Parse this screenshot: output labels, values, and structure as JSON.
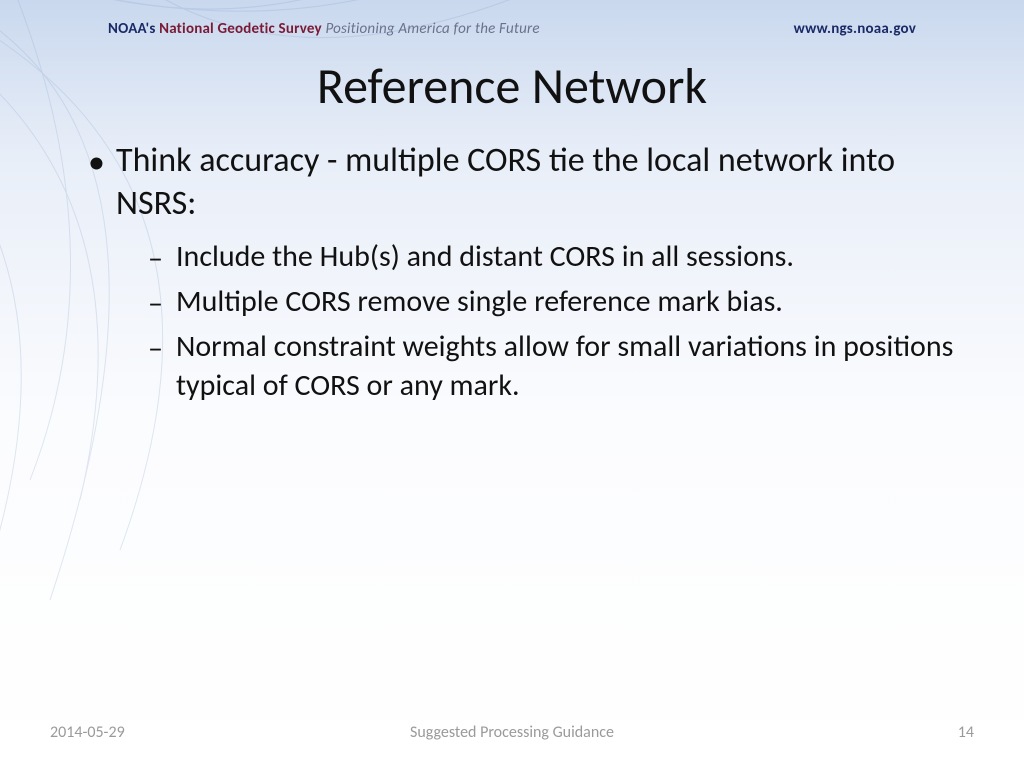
{
  "header": {
    "org1": "NOAA's",
    "org2": "National Geodetic Survey",
    "tagline": "Positioning America for the Future",
    "url": "www.ngs.noaa.gov"
  },
  "title": "Reference Network",
  "bullets": {
    "level1": "Think accuracy - multiple CORS tie the local network into NSRS:",
    "level2": [
      "Include the Hub(s) and distant CORS in all sessions.",
      "Multiple CORS remove single reference mark bias.",
      "Normal constraint weights allow for small variations in positions typical of CORS or any mark."
    ]
  },
  "footer": {
    "date": "2014-05-29",
    "center": "Suggested Processing Guidance",
    "page": "14"
  },
  "colors": {
    "header_navy": "#1b2a66",
    "header_maroon": "#7a1a35",
    "footer_gray": "#9a9a9a"
  }
}
